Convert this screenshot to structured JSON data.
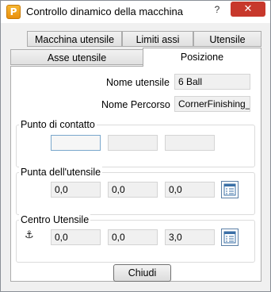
{
  "window": {
    "title": "Controllo dinamico della macchina",
    "app_icon_letter": "P",
    "help_glyph": "?",
    "close_glyph": "✕"
  },
  "tabs": {
    "row_back": [
      "Macchina utensile",
      "Limiti assi",
      "Utensile"
    ],
    "row_front": [
      "Asse utensile",
      "Posizione"
    ],
    "active": "Posizione"
  },
  "tool_info": {
    "name_label": "Nome utensile",
    "name_value": "6 Ball",
    "path_label": "Nome Percorso",
    "path_value": "CornerFinishing_"
  },
  "contact_point": {
    "title": "Punto di contatto",
    "values": [
      "",
      "",
      ""
    ]
  },
  "tool_tip": {
    "title": "Punta dell'utensile",
    "values": [
      "0,0",
      "0,0",
      "0,0"
    ],
    "button_icon": "list-edit-icon"
  },
  "tool_center": {
    "title": "Centro Utensile",
    "anchor_icon": "anchor-icon",
    "anchor_glyph": "⚓",
    "values": [
      "0,0",
      "0,0",
      "3,0"
    ],
    "button_icon": "list-edit-icon"
  },
  "footer": {
    "close_label": "Chiudi"
  },
  "colors": {
    "close_button_red": "#c7382c",
    "app_icon_orange": "#f0a020",
    "focus_border": "#7aa7cc"
  }
}
